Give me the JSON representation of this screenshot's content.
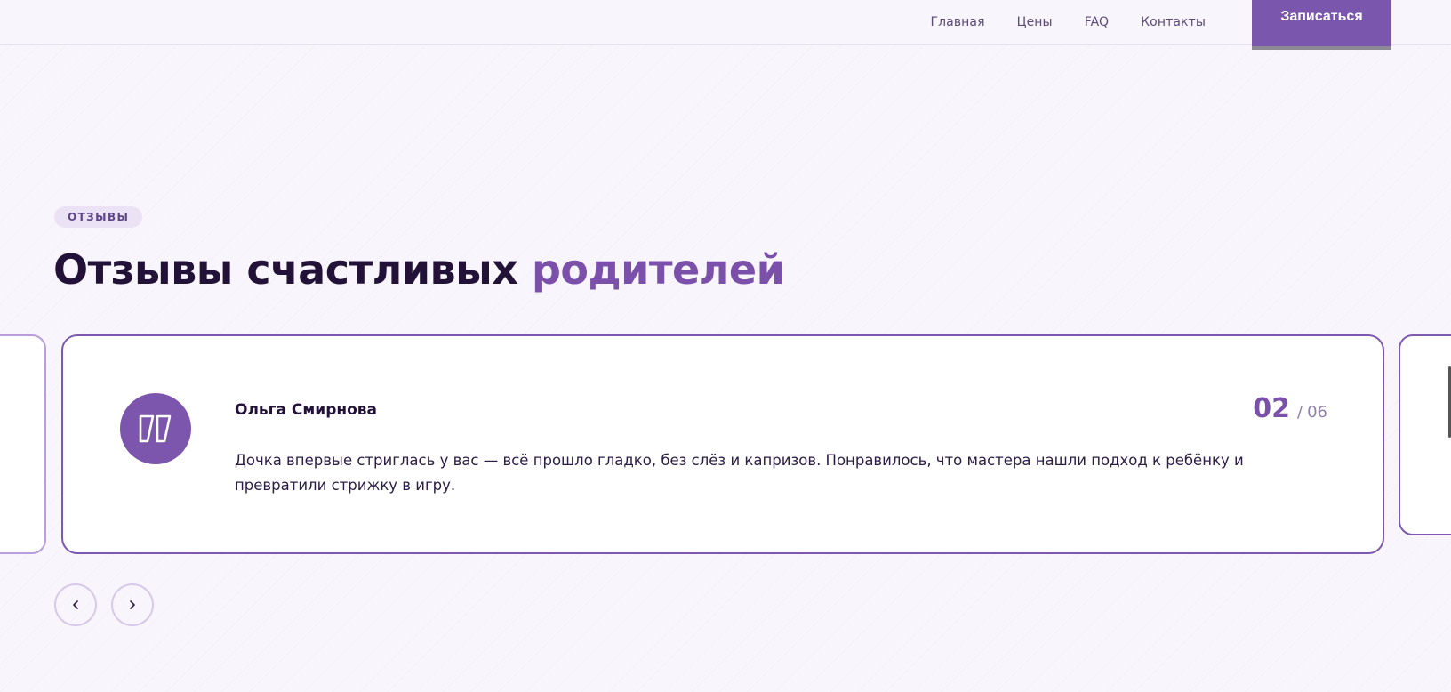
{
  "header": {
    "nav": [
      "Главная",
      "Цены",
      "FAQ",
      "Контакты"
    ],
    "cta_label": "Записаться"
  },
  "section": {
    "badge": "ОТЗЫВЫ",
    "title_main": "Отзывы счастливых ",
    "title_accent": "родителей"
  },
  "review": {
    "author": "Ольга Смирнова",
    "current": "02",
    "separator": "/",
    "total": "06",
    "text": "Дочка впервые стриглась у вас — всё прошло гладко, без слёз и капризов. Понравилось, что мастера нашли подход к ребёнку и превратили стрижку в игру."
  },
  "icons": {
    "quote": "quote-icon",
    "prev": "chevron-left-icon",
    "next": "chevron-right-icon"
  },
  "colors": {
    "accent": "#7b56ad",
    "heading": "#221238",
    "background": "#f8f6fc"
  }
}
